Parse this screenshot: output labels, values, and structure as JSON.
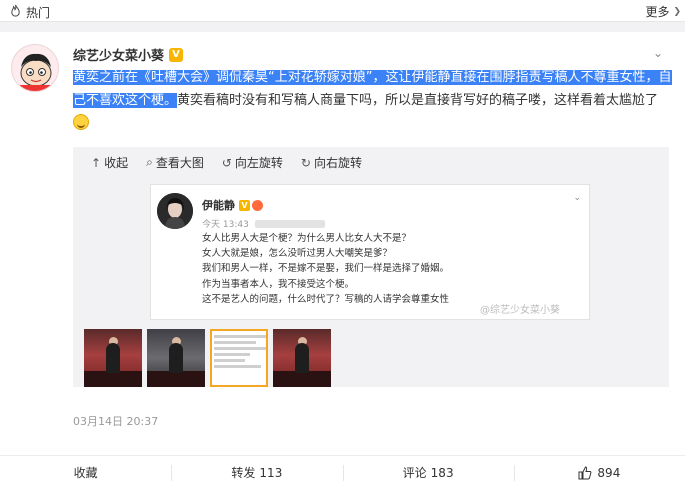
{
  "topbar": {
    "title": "热门",
    "more": "更多",
    "flame_icon": "flame-icon"
  },
  "post": {
    "username": "综艺少女菜小葵",
    "badge": "V",
    "text_seg1": "黄奕之前在",
    "text_link": "《吐槽大会》",
    "text_seg2": "调侃秦昊“上对花轿嫁对娘”，这让伊能静直接在围脖指责写稿人不尊重女性，自己不喜欢这个梗。",
    "text_seg3": "黄奕看稿时没有和写稿人商量下吗，所以是直接背写好的稿子喽，这样看着太尴尬了",
    "date": "03月14日 20:37"
  },
  "media": {
    "tools": {
      "collapse": "收起",
      "view_large": "查看大图",
      "rotate_left": "向左旋转",
      "rotate_right": "向右旋转"
    },
    "embedded": {
      "name": "伊能静",
      "time": "今天 13:43",
      "lines": [
        "女人比男人大是个梗？为什么男人比女人大不是？",
        "女人大就是娘，怎么没听过男人大嘲笑是爹？",
        "我们和男人一样，不是嫁不是娶，我们一样是选择了婚姻。",
        "作为当事者本人，我不接受这个梗。",
        "这不是艺人的问题，什么时代了？写稿的人请学会尊重女性"
      ],
      "watermark": "@综艺少女菜小葵"
    },
    "thumbs": 4,
    "selected_thumb": 3
  },
  "actions": {
    "favorite": "收藏",
    "repost": "转发",
    "repost_count": "113",
    "comment": "评论",
    "comment_count": "183",
    "like_count": "894"
  }
}
